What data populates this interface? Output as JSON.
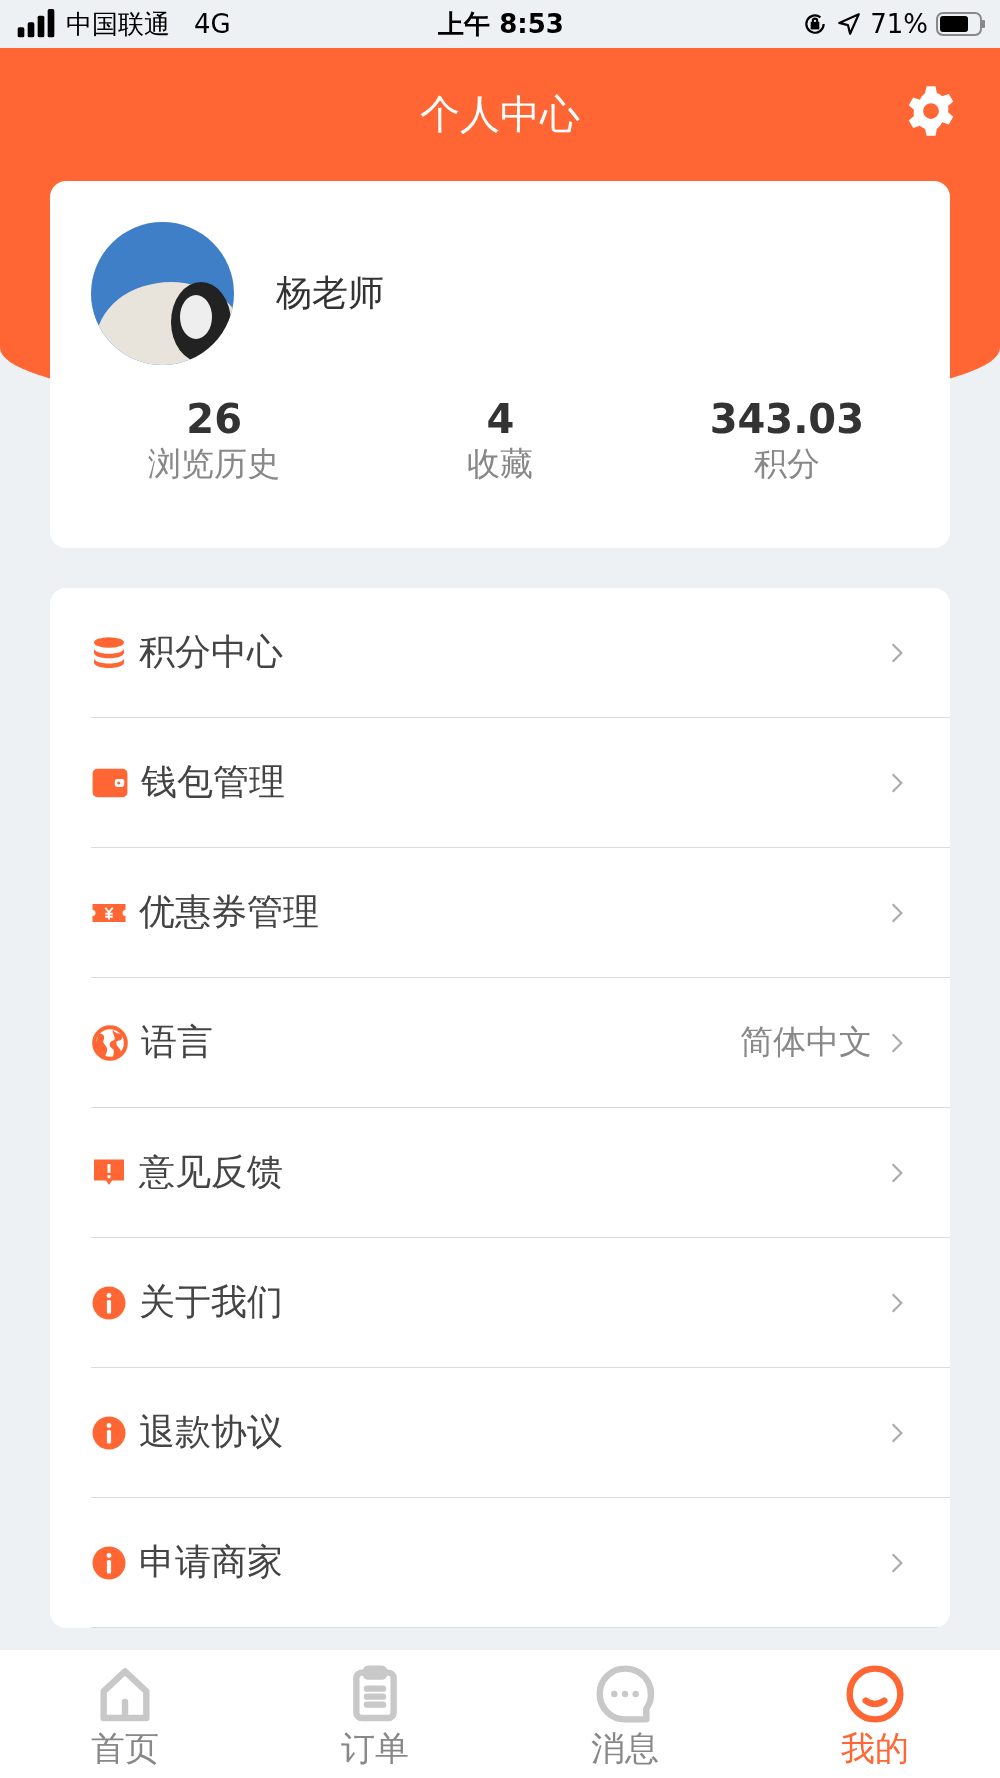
{
  "status_bar": {
    "carrier": "中国联通",
    "network": "4G",
    "time": "上午 8:53",
    "battery": "71%"
  },
  "header": {
    "title": "个人中心"
  },
  "profile": {
    "name": "杨老师",
    "stats": [
      {
        "value": "26",
        "label": "浏览历史"
      },
      {
        "value": "4",
        "label": "收藏"
      },
      {
        "value": "343.03",
        "label": "积分"
      }
    ]
  },
  "menu": [
    {
      "kind": "coins",
      "label": "积分中心"
    },
    {
      "kind": "wallet",
      "label": "钱包管理"
    },
    {
      "kind": "coupon",
      "label": "优惠券管理"
    },
    {
      "kind": "globe",
      "label": "语言",
      "value": "简体中文"
    },
    {
      "kind": "feedback",
      "label": "意见反馈"
    },
    {
      "kind": "info",
      "label": "关于我们"
    },
    {
      "kind": "info",
      "label": "退款协议"
    },
    {
      "kind": "info",
      "label": "申请商家"
    }
  ],
  "tab_bar": [
    {
      "kind": "home",
      "label": "首页",
      "selected": false
    },
    {
      "kind": "orders",
      "label": "订单",
      "selected": false
    },
    {
      "kind": "messages",
      "label": "消息",
      "selected": false
    },
    {
      "kind": "profile",
      "label": "我的",
      "selected": true
    }
  ]
}
